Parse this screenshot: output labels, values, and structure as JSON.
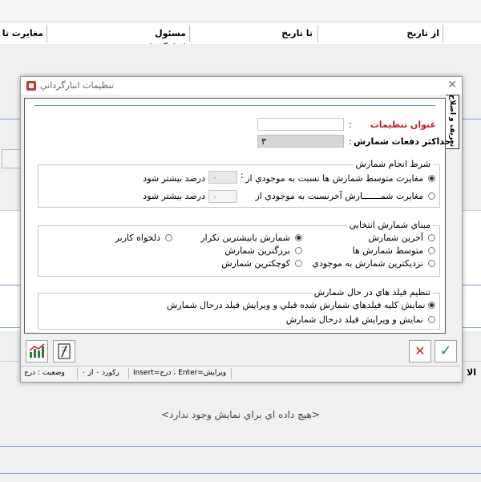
{
  "background": {
    "columns": [
      "از تاريخ",
      "تا تاريخ",
      "مسئول انبارگرداني",
      "مغايرت تا تا"
    ],
    "no_data": "<هيچ داده اي براي نمايش وجود ندارد>",
    "bottom_label": "الا"
  },
  "dialog": {
    "title": "تنظيمات انبارگرداني",
    "side_tab": "تعريف و اصلاح",
    "fields": {
      "title_label": "عنوان تنظيمات",
      "title_value": "",
      "max_count_label": "حداكثر دفعات شمارش",
      "max_count_value": "۳",
      "colon": ":"
    },
    "condition_group": {
      "title": "شرط انجام شمارش",
      "row1_label": "مغايرت متوسط شمارش ها نسبت به موجودي از",
      "row1_value": "۰",
      "row1_suffix": "درصد بيشتر شود",
      "row2_label": "مغايرت شمـــــــارش آخرنسبت به موجودي از",
      "row2_value": "۰",
      "row2_suffix": "درصد بيشتر شود"
    },
    "basis_group": {
      "title": "مبناي شمارش انتخابي",
      "options": [
        "آخرين شمارش",
        "شمارش بابيشترين تكرار",
        "دلخواه كاربر",
        "متوسط شمارش ها",
        "بزرگترين شمارش",
        "نزديكترين شمارش به موجودي",
        "كوچكترين شمارش"
      ]
    },
    "fields_group": {
      "title": "تنظيم فيلد هاي در حال شمارش",
      "option1": "نمايش كليه فيلدهاي شمارش شده قبلي و ويرايش فيلد درحال شمارش",
      "option2": "نمايش و ويرايش فيلد درحال شمارش"
    },
    "buttons": {
      "confirm": "✓",
      "cancel": "✕"
    },
    "status": {
      "shortcuts": "Insert=درج ، Enter=ويرايش",
      "record": "ركورد ۰ از ۰",
      "state": "وضعيت : درج"
    },
    "colors": {
      "accent_line": "#5a8fd1",
      "confirm_green": "#1f9a3a",
      "cancel_red": "#d62020",
      "title_red": "#b22222"
    }
  }
}
